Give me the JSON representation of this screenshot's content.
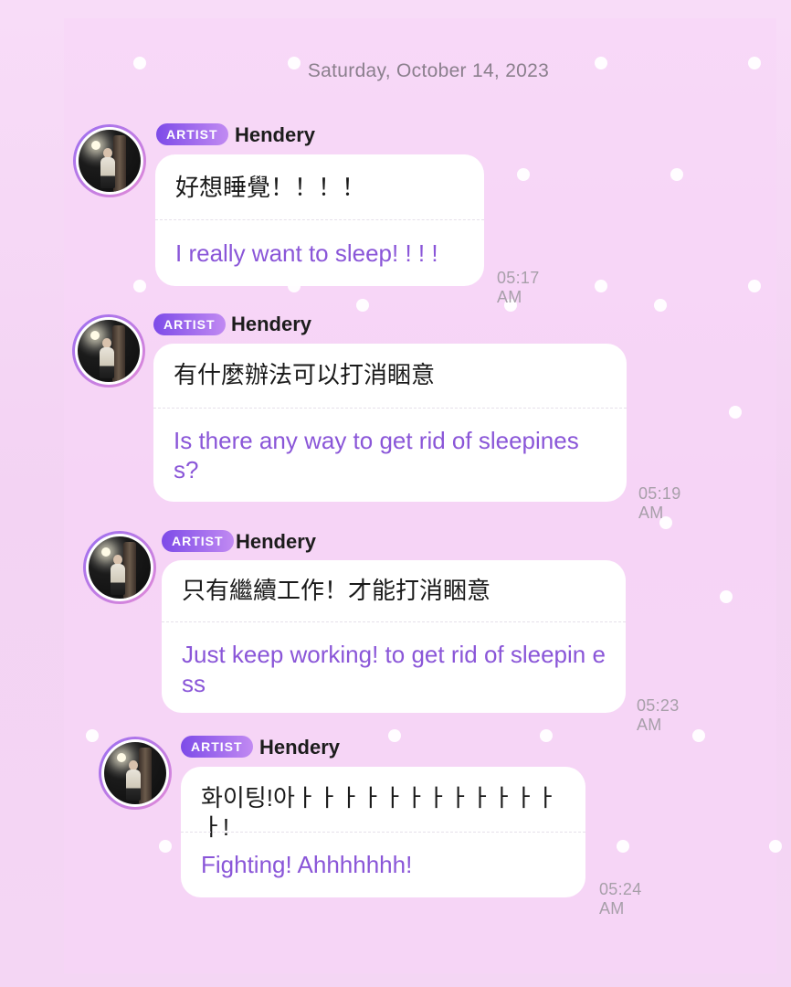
{
  "date_header": "Saturday, October 14, 2023",
  "colors": {
    "background": "#f6d6f6",
    "translation": "#8a56d8",
    "badge": "#7d4be8",
    "timestamp": "#a79fa9"
  },
  "messages": [
    {
      "badge": "ARTIST",
      "sender": "Hendery",
      "original": "好想睡覺！！！！",
      "translation": "I really want to sleep! ! ! !",
      "time": "05:17 AM"
    },
    {
      "badge": "ARTIST",
      "sender": "Hendery",
      "original": "有什麼辦法可以打消睏意",
      "translation": "Is there any way to get rid of sleepines s?",
      "time": "05:19 AM"
    },
    {
      "badge": "ARTIST",
      "sender": "Hendery",
      "original": "只有繼續工作！才能打消睏意",
      "translation": "Just keep working! to get rid of sleepin ess",
      "time": "05:23 AM"
    },
    {
      "badge": "ARTIST",
      "sender": "Hendery",
      "original": "화이팅!아ㅏㅏㅏㅏㅏㅏㅏㅏㅏㅏㅏㅏㅏ!",
      "translation": "Fighting! Ahhhhhhh!",
      "time": "05:24 AM"
    }
  ]
}
